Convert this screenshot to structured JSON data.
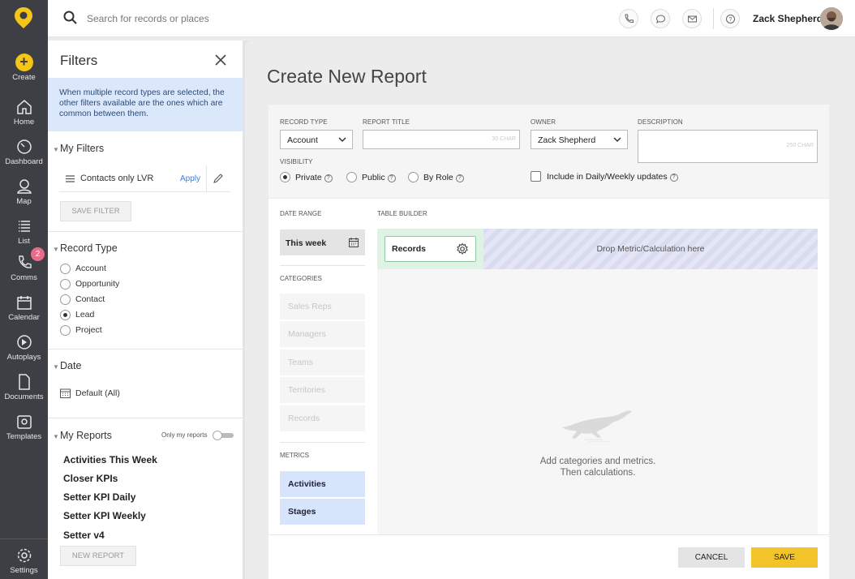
{
  "brand": {
    "accent": "#f5c518",
    "rail_bg": "#3d3f44"
  },
  "nav": {
    "create": "Create",
    "items": [
      {
        "label": "Home",
        "icon": "home-icon"
      },
      {
        "label": "Dashboard",
        "icon": "dashboard-icon"
      },
      {
        "label": "Map",
        "icon": "map-pin-icon"
      },
      {
        "label": "List",
        "icon": "list-icon"
      },
      {
        "label": "Comms",
        "icon": "phone-icon",
        "badge": "2"
      },
      {
        "label": "Calendar",
        "icon": "calendar-icon"
      },
      {
        "label": "Autoplays",
        "icon": "autoplay-icon"
      },
      {
        "label": "Documents",
        "icon": "document-icon"
      },
      {
        "label": "Templates",
        "icon": "templates-icon"
      }
    ],
    "settings": "Settings"
  },
  "topbar": {
    "search_placeholder": "Search for records or places",
    "user_name": "Zack Shepherd"
  },
  "filters": {
    "title": "Filters",
    "info": "When multiple record types are selected, the other filters available are the ones which are common between them.",
    "my_filters": {
      "header": "My Filters",
      "saved_name": "Contacts only LVR",
      "apply": "Apply",
      "save_button": "SAVE FILTER"
    },
    "record_type": {
      "header": "Record Type",
      "options": [
        "Account",
        "Opportunity",
        "Contact",
        "Lead",
        "Project"
      ],
      "selected": "Lead"
    },
    "date": {
      "header": "Date",
      "value": "Default (All)"
    },
    "my_reports": {
      "header": "My Reports",
      "only_mine": "Only my reports",
      "reports": [
        "Activities This Week",
        "Closer KPIs",
        "Setter KPI Daily",
        "Setter KPI Weekly",
        "Setter v4"
      ],
      "new_button": "NEW REPORT"
    }
  },
  "report": {
    "title": "Create New Report",
    "record_type_label": "RECORD TYPE",
    "record_type_value": "Account",
    "report_title_label": "REPORT TITLE",
    "report_title_hint": "30 CHAR",
    "owner_label": "OWNER",
    "owner_value": "Zack Shepherd",
    "description_label": "DESCRIPTION",
    "description_hint": "250 CHAR",
    "visibility_label": "VISIBILITY",
    "visibility_options": [
      "Private",
      "Public",
      "By Role"
    ],
    "visibility_selected": "Private",
    "include_updates": "Include in Daily/Weekly updates",
    "date_range_label": "DATE RANGE",
    "date_range_value": "This week",
    "categories_label": "CATEGORIES",
    "categories": [
      "Sales Reps",
      "Managers",
      "Teams",
      "Territories",
      "Records"
    ],
    "metrics_label": "METRICS",
    "metrics": [
      "Activities",
      "Stages"
    ],
    "table_builder_label": "TABLE BUILDER",
    "records_chip": "Records",
    "drop_text": "Drop Metric/Calculation here",
    "empty_line1": "Add categories and metrics.",
    "empty_line2": "Then calculations.",
    "cancel": "CANCEL",
    "save": "SAVE"
  }
}
